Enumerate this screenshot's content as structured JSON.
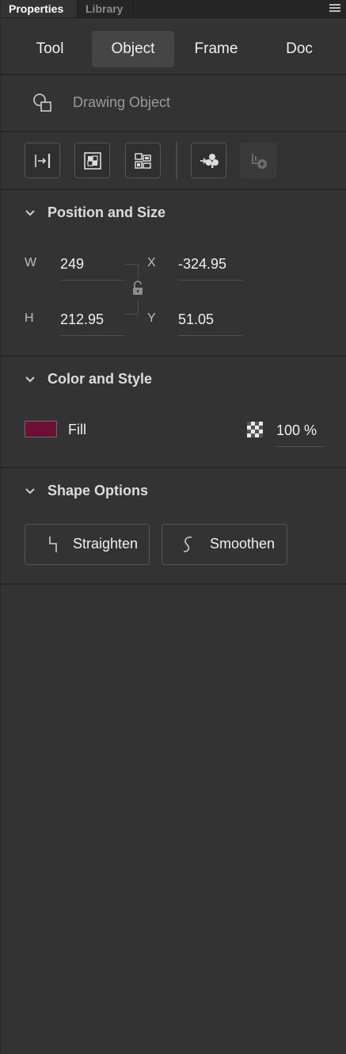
{
  "tabs": {
    "properties": "Properties",
    "library": "Library"
  },
  "modes": [
    {
      "label": "Tool",
      "selected": false
    },
    {
      "label": "Object",
      "selected": true
    },
    {
      "label": "Frame",
      "selected": false
    },
    {
      "label": "Doc",
      "selected": false
    }
  ],
  "object": {
    "type_label": "Drawing Object",
    "icon": "drawing-object-icon"
  },
  "toolbar": {
    "buttons": [
      {
        "icon": "align-icon",
        "enabled": true
      },
      {
        "icon": "break-apart-icon",
        "enabled": true
      },
      {
        "icon": "group-icon",
        "enabled": true
      },
      {
        "icon": "convert-to-symbol-icon",
        "enabled": true
      },
      {
        "icon": "add-to-library-icon",
        "enabled": false
      }
    ]
  },
  "position_size": {
    "title": "Position and Size",
    "w_label": "W",
    "w_value": "249",
    "h_label": "H",
    "h_value": "212.95",
    "x_label": "X",
    "x_value": "-324.95",
    "y_label": "Y",
    "y_value": "51.05",
    "constrain_locked": false
  },
  "color_style": {
    "title": "Color and Style",
    "fill_label": "Fill",
    "fill_color": "#6b0f34",
    "alpha_value": "100 %"
  },
  "shape_options": {
    "title": "Shape Options",
    "straighten_label": "Straighten",
    "smoothen_label": "Smoothen"
  }
}
